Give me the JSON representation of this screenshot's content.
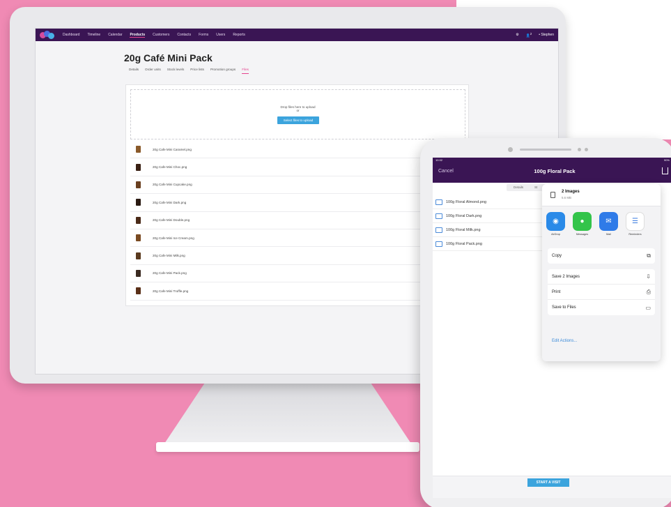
{
  "desktop": {
    "nav": {
      "items": [
        "Dashboard",
        "Timeline",
        "Calendar",
        "Products",
        "Customers",
        "Contacts",
        "Forms",
        "Users",
        "Reports"
      ],
      "user": "• Stephen",
      "badge": "2"
    },
    "page_title": "20g Café Mini Pack",
    "tabs": [
      "Details",
      "Order units",
      "Stock levels",
      "Price lists",
      "Promotion groups",
      "Files"
    ],
    "dropzone": {
      "text": "Drop files here to upload",
      "or": "or",
      "button": "Select files to upload"
    },
    "files": [
      {
        "name": "20g Cafe Mini Caramel.png",
        "color": "#8a5a2a"
      },
      {
        "name": "20g Cafe Mini Choc.png",
        "color": "#3a2014"
      },
      {
        "name": "20g Cafe Mini Cupcake.png",
        "color": "#6a4020"
      },
      {
        "name": "20g Cafe Mini Dark.png",
        "color": "#2a1a12"
      },
      {
        "name": "20g Cafe Mini Double.png",
        "color": "#4a2a18"
      },
      {
        "name": "20g Cafe Mini Ice Cream.png",
        "color": "#7a4a22"
      },
      {
        "name": "20g Cafe Mini Milk.png",
        "color": "#5a3a1e"
      },
      {
        "name": "20g Cafe Mini Pack.png",
        "color": "#3a2a20"
      },
      {
        "name": "20g Cafe Mini Truffle.png",
        "color": "#5a3018"
      }
    ]
  },
  "ipad": {
    "status_time": "10:32",
    "status_right": "90%",
    "cancel": "Cancel",
    "title": "100g Floral Pack",
    "segment": [
      "Details",
      "St"
    ],
    "files": [
      "100g Floral Almond.png",
      "100g Floral Dark.png",
      "100g Floral Milk.png",
      "100g Floral Pack.png"
    ],
    "bottom_button": "START A VISIT",
    "share": {
      "title": "2 Images",
      "size": "5.6 MB",
      "apps": [
        {
          "label": "AirDrop",
          "color": "#2a8ae8",
          "icon": "airdrop-icon"
        },
        {
          "label": "Messages",
          "color": "#33c44a",
          "icon": "messages-icon"
        },
        {
          "label": "Mail",
          "color": "#2f7be8",
          "icon": "mail-icon"
        },
        {
          "label": "Reminders",
          "color": "#ffffff",
          "icon": "reminders-icon"
        }
      ],
      "actions_a": [
        {
          "label": "Copy",
          "icon": "copy-icon"
        }
      ],
      "actions_b": [
        {
          "label": "Save 2 Images",
          "icon": "save-icon"
        },
        {
          "label": "Print",
          "icon": "print-icon"
        },
        {
          "label": "Save to Files",
          "icon": "folder-icon"
        }
      ],
      "edit": "Edit Actions..."
    }
  }
}
